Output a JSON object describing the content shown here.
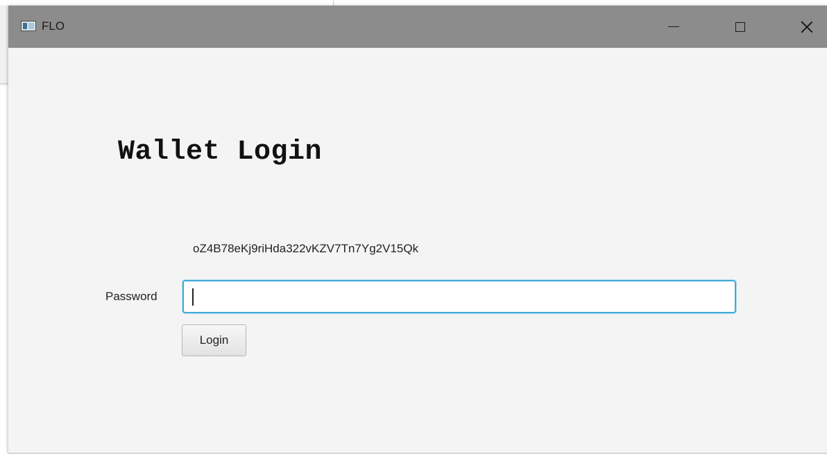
{
  "window": {
    "title": "FLO",
    "controls": {
      "minimize_icon": "minimize-icon",
      "maximize_icon": "maximize-icon",
      "close_icon": "close-icon"
    },
    "titlebar_color": "#8c8c8c",
    "background_color": "#f4f4f4"
  },
  "login": {
    "heading": "Wallet Login",
    "address": "oZ4B78eKj9riHda322vKZV7Tn7Yg2V15Qk",
    "password_label": "Password",
    "password_value": "",
    "password_placeholder": "",
    "login_button_label": "Login",
    "focus_color": "#3fa9d8"
  }
}
